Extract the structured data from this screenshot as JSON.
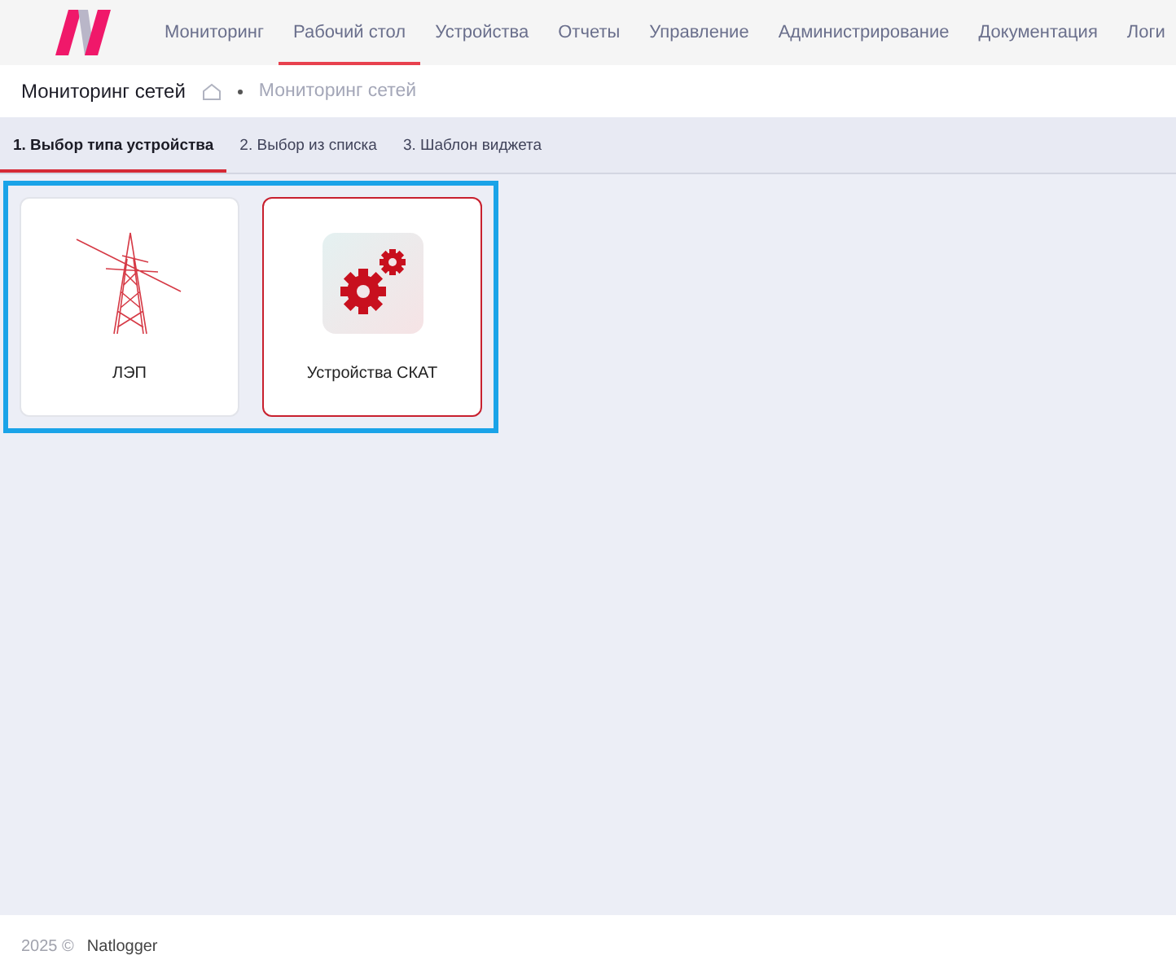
{
  "nav": {
    "items": [
      {
        "label": "Мониторинг",
        "selected": false
      },
      {
        "label": "Рабочий стол",
        "selected": true
      },
      {
        "label": "Устройства",
        "selected": false
      },
      {
        "label": "Отчеты",
        "selected": false
      },
      {
        "label": "Управление",
        "selected": false
      },
      {
        "label": "Администрирование",
        "selected": false
      },
      {
        "label": "Документация",
        "selected": false
      },
      {
        "label": "Логи",
        "selected": false
      }
    ]
  },
  "page_title": "Мониторинг сетей",
  "breadcrumb": "Мониторинг сетей",
  "steps": [
    {
      "label": "1. Выбор типа устройства",
      "selected": true
    },
    {
      "label": "2. Выбор из списка",
      "selected": false
    },
    {
      "label": "3. Шаблон виджета",
      "selected": false
    }
  ],
  "device_types": [
    {
      "kind": "tower",
      "label": "ЛЭП",
      "selected": false
    },
    {
      "kind": "gears",
      "label": "Устройства СКАТ",
      "selected": true
    }
  ],
  "footer": {
    "year": "2025 ©",
    "brand": "Natlogger"
  }
}
